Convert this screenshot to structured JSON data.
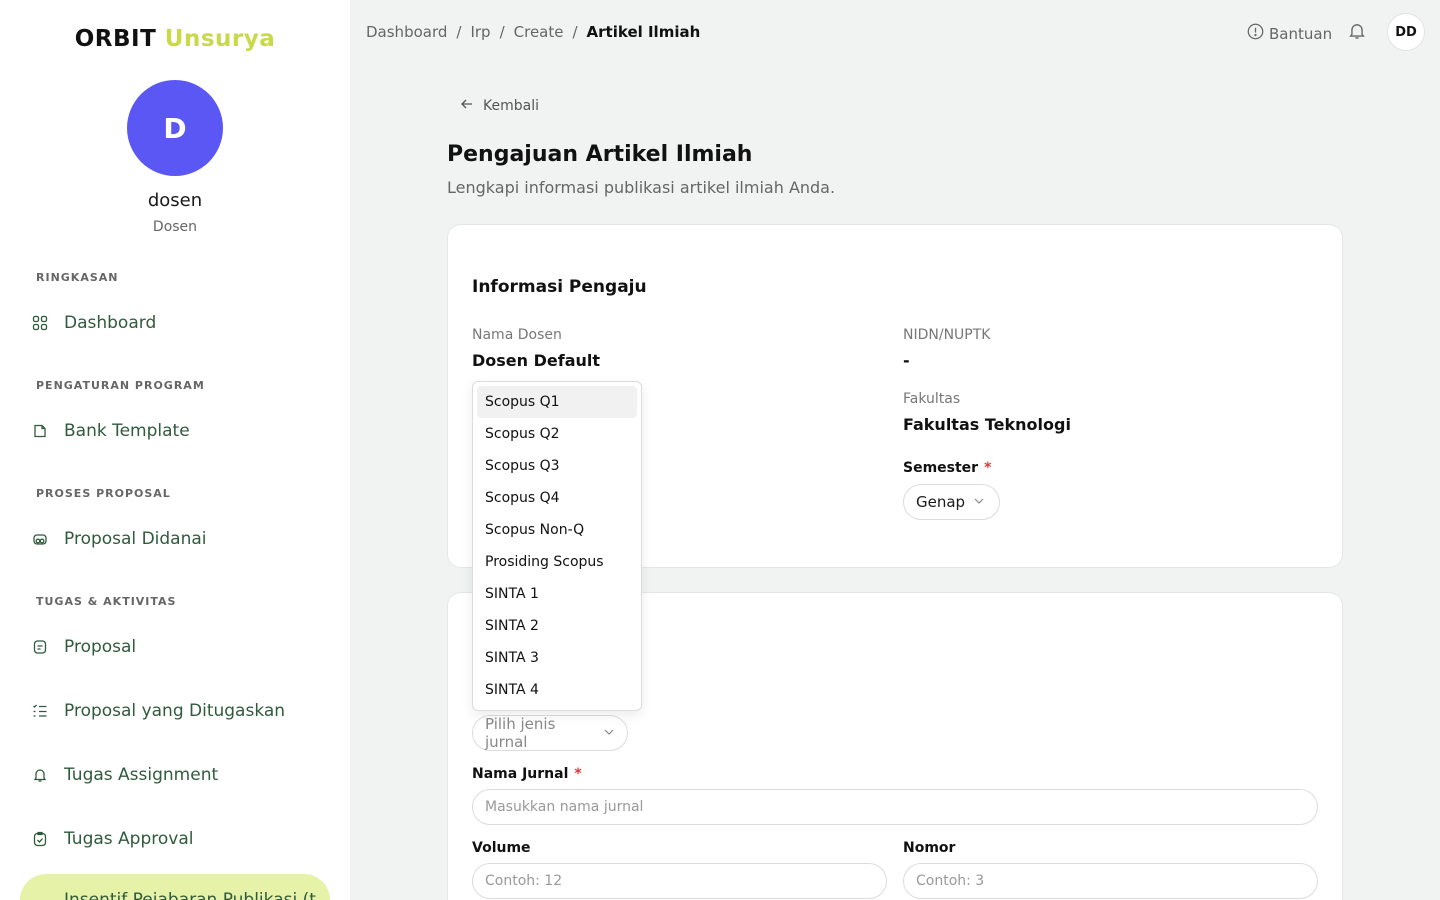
{
  "app": {
    "brand_part1": "ORBIT",
    "brand_part2": "Unsurya",
    "accent_color": "#c9d94a",
    "avatar_color": "#5b57f5"
  },
  "user": {
    "initial": "D",
    "name": "dosen",
    "role": "Dosen",
    "top_initials": "DD"
  },
  "sidebar": {
    "sections": [
      {
        "label": "RINGKASAN"
      },
      {
        "label": "PENGATURAN PROGRAM"
      },
      {
        "label": "PROSES PROPOSAL"
      },
      {
        "label": "TUGAS & AKTIVITAS"
      }
    ],
    "items": [
      {
        "label": "Dashboard",
        "icon": "grid-icon"
      },
      {
        "label": "Bank Template",
        "icon": "document-icon"
      },
      {
        "label": "Proposal Didanai",
        "icon": "money-icon"
      },
      {
        "label": "Proposal",
        "icon": "file-icon"
      },
      {
        "label": "Proposal yang Ditugaskan",
        "icon": "list-check-icon"
      },
      {
        "label": "Tugas Assignment",
        "icon": "bell-icon"
      },
      {
        "label": "Tugas Approval",
        "icon": "clipboard-check-icon"
      },
      {
        "label": "Insentif Pejabaran Publikasi (t",
        "icon": "double-arrow-icon"
      }
    ]
  },
  "breadcrumb": {
    "items": [
      "Dashboard",
      "Irp",
      "Create"
    ],
    "current": "Artikel Ilmiah"
  },
  "topbar": {
    "help_label": "Bantuan"
  },
  "page": {
    "back_label": "Kembali",
    "title": "Pengajuan Artikel Ilmiah",
    "subtitle": "Lengkapi informasi publikasi artikel ilmiah Anda."
  },
  "card1": {
    "title": "Informasi Pengaju",
    "nama_dosen_label": "Nama Dosen",
    "nama_dosen_value": "Dosen Default",
    "nidn_label": "NIDN/NUPTK",
    "nidn_value": "-",
    "fakultas_label": "Fakultas",
    "fakultas_value": "Fakultas Teknologi",
    "semester_label": "Semester",
    "semester_value": "Genap"
  },
  "card2": {
    "jenis_placeholder": "Pilih jenis jurnal",
    "nama_jurnal_label": "Nama Jurnal",
    "nama_jurnal_placeholder": "Masukkan nama jurnal",
    "volume_label": "Volume",
    "volume_placeholder": "Contoh: 12",
    "nomor_label": "Nomor",
    "nomor_placeholder": "Contoh: 3"
  },
  "dropdown": {
    "options": [
      "Scopus Q1",
      "Scopus Q2",
      "Scopus Q3",
      "Scopus Q4",
      "Scopus Non-Q",
      "Prosiding Scopus",
      "SINTA 1",
      "SINTA 2",
      "SINTA 3",
      "SINTA 4"
    ],
    "highlighted": "Scopus Q1"
  }
}
